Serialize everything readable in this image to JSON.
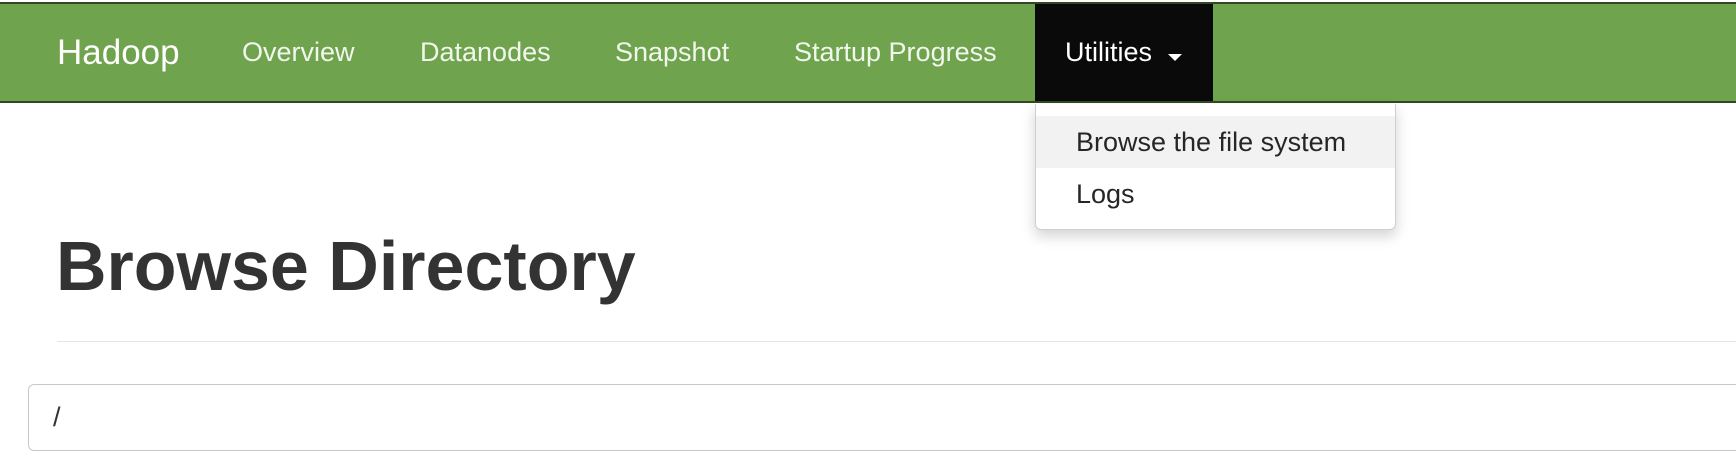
{
  "navbar": {
    "brand": "Hadoop",
    "items": [
      {
        "label": "Overview"
      },
      {
        "label": "Datanodes"
      },
      {
        "label": "Snapshot"
      },
      {
        "label": "Startup Progress"
      }
    ],
    "active_item": {
      "label": "Utilities",
      "state": "open"
    },
    "colors": {
      "background": "#6fa34d",
      "active_background": "#0a0a0a"
    }
  },
  "dropdown": {
    "items": [
      {
        "label": "Browse the file system",
        "highlighted": true
      },
      {
        "label": "Logs",
        "highlighted": false
      }
    ]
  },
  "main": {
    "title": "Browse Directory",
    "path_input": {
      "value": "/"
    }
  }
}
